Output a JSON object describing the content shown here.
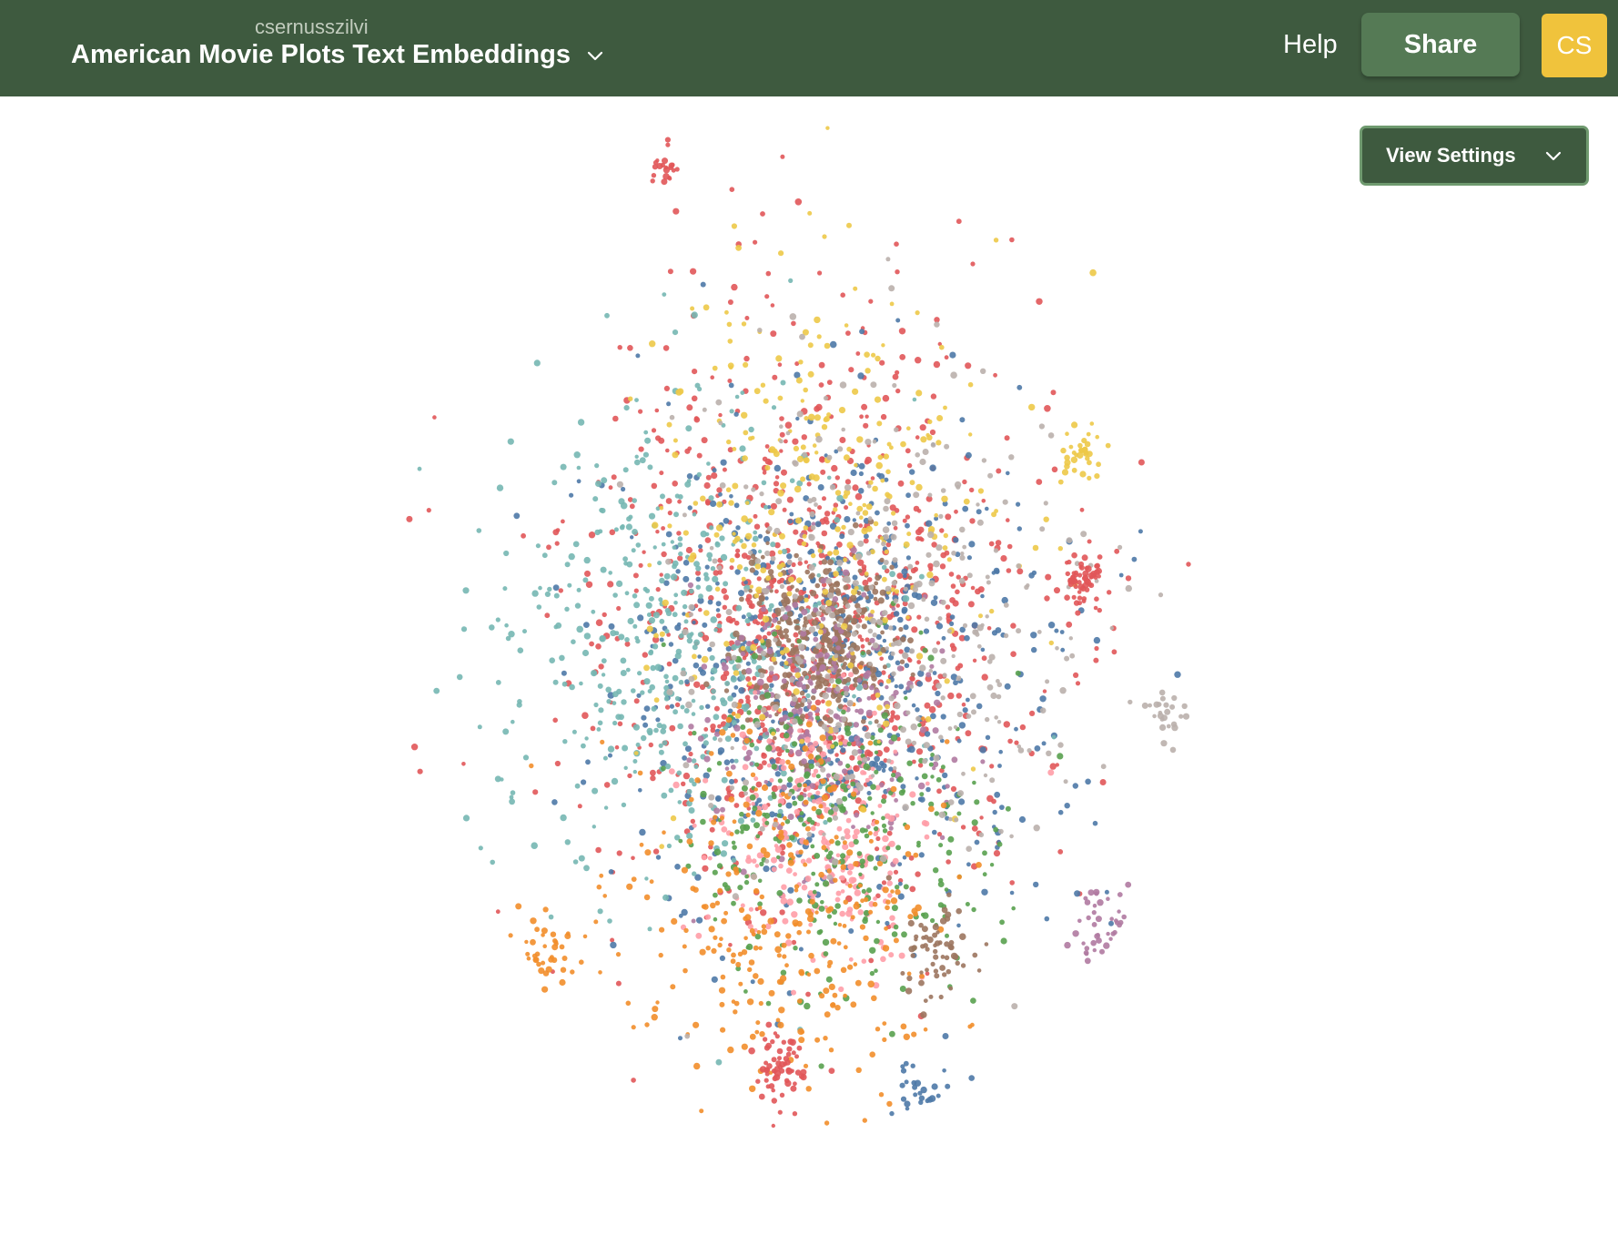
{
  "header": {
    "owner": "csernusszilvi",
    "title": "American Movie Plots Text Embeddings",
    "help_label": "Help",
    "share_label": "Share",
    "avatar_initials": "CS"
  },
  "toolbar": {
    "view_settings_label": "View Settings"
  },
  "colors": {
    "header_bg": "#3e5a3f",
    "share_bg": "#557a55",
    "avatar_bg": "#f0c33c",
    "palette": [
      "#e15759",
      "#4e79a7",
      "#f28e2b",
      "#76b7b2",
      "#59a14f",
      "#edc948",
      "#b07aa1",
      "#ff9da7",
      "#9c755f",
      "#bab0ac"
    ]
  },
  "icons": {
    "title_dropdown": "chevron-down-icon",
    "view_settings_dropdown": "chevron-down-icon"
  },
  "chart_data": {
    "type": "scatter",
    "title": "",
    "xlabel": "",
    "ylabel": "",
    "description": "Roughly 4500 embedding points in a 2D projection, colored by 10 categorical clusters; no axes, ticks or legend shown.",
    "categories_count": 10,
    "clusters": [
      {
        "color_index": 0,
        "cx": 0.0,
        "cy": 0.0,
        "spread": 0.55,
        "count": 900
      },
      {
        "color_index": 1,
        "cx": 0.1,
        "cy": 0.1,
        "spread": 0.5,
        "count": 600
      },
      {
        "color_index": 3,
        "cx": -0.3,
        "cy": 0.05,
        "spread": 0.45,
        "count": 500
      },
      {
        "color_index": 8,
        "cx": 0.05,
        "cy": 0.05,
        "spread": 0.18,
        "count": 350
      },
      {
        "color_index": 6,
        "cx": 0.05,
        "cy": 0.2,
        "spread": 0.25,
        "count": 250
      },
      {
        "color_index": 7,
        "cx": 0.05,
        "cy": 0.45,
        "spread": 0.25,
        "count": 250
      },
      {
        "color_index": 4,
        "cx": 0.1,
        "cy": 0.45,
        "spread": 0.35,
        "count": 300
      },
      {
        "color_index": 2,
        "cx": -0.05,
        "cy": 0.6,
        "spread": 0.35,
        "count": 300
      },
      {
        "color_index": 5,
        "cx": 0.05,
        "cy": -0.2,
        "spread": 0.45,
        "count": 300
      },
      {
        "color_index": 9,
        "cx": 0.2,
        "cy": 0.0,
        "spread": 0.45,
        "count": 350
      },
      {
        "color_index": 0,
        "cx": 0.72,
        "cy": -0.08,
        "spread": 0.05,
        "count": 60
      },
      {
        "color_index": 0,
        "cx": -0.05,
        "cy": 0.95,
        "spread": 0.07,
        "count": 60
      },
      {
        "color_index": 0,
        "cx": -0.35,
        "cy": -0.95,
        "spread": 0.03,
        "count": 20
      },
      {
        "color_index": 5,
        "cx": 0.72,
        "cy": -0.35,
        "spread": 0.05,
        "count": 35
      },
      {
        "color_index": 9,
        "cx": 0.92,
        "cy": 0.2,
        "spread": 0.05,
        "count": 25
      },
      {
        "color_index": 6,
        "cx": 0.78,
        "cy": 0.65,
        "spread": 0.08,
        "count": 40
      },
      {
        "color_index": 8,
        "cx": 0.35,
        "cy": 0.7,
        "spread": 0.1,
        "count": 60
      },
      {
        "color_index": 2,
        "cx": -0.65,
        "cy": 0.7,
        "spread": 0.08,
        "count": 40
      },
      {
        "color_index": 1,
        "cx": 0.3,
        "cy": 1.0,
        "spread": 0.07,
        "count": 25
      }
    ]
  }
}
